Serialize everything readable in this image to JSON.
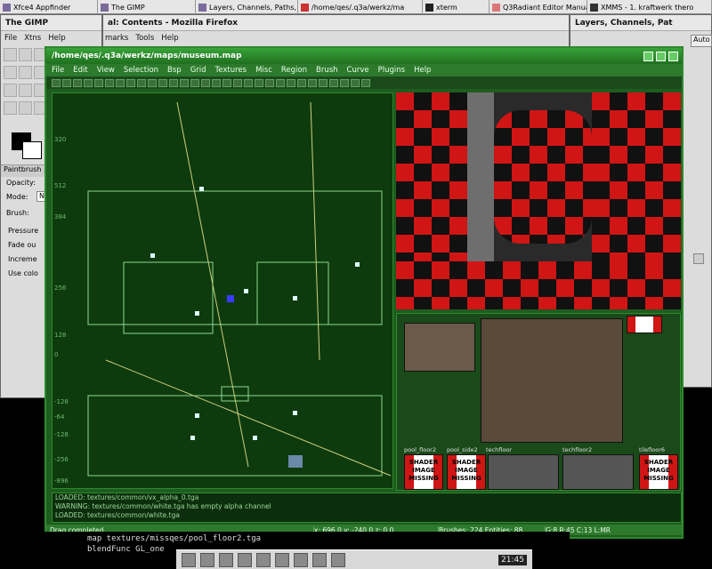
{
  "taskbar": {
    "items": [
      "Xfce4 Appfinder",
      "The GIMP",
      "Layers, Channels, Paths, U",
      "/home/qes/.q3a/werkz/ma",
      "xterm",
      "Q3Radiant Editor Manual: ",
      "XMMS - 1. kraftwerk thero"
    ]
  },
  "gimp": {
    "title": "The GIMP",
    "menu": [
      "File",
      "Xtns",
      "Help"
    ],
    "tool_options_title": "Paintbrush",
    "opacity_label": "Opacity:",
    "mode_label": "Mode:",
    "mode_value": "No",
    "brush_label": "Brush:",
    "pressure_label": "Pressure",
    "fade_label": "Fade ou",
    "increment_label": "Increme",
    "color_label": "Use colo"
  },
  "firefox": {
    "title": "al: Contents - Mozilla Firefox",
    "menu": [
      "marks",
      "Tools",
      "Help"
    ]
  },
  "layers": {
    "title": "Layers, Channels, Pat",
    "auto_label": "Auto"
  },
  "radiant": {
    "title": "/home/qes/.q3a/werkz/maps/museum.map",
    "menu": [
      "File",
      "Edit",
      "View",
      "Selection",
      "Bsp",
      "Grid",
      "Textures",
      "Misc",
      "Region",
      "Brush",
      "Curve",
      "Plugins",
      "Help"
    ],
    "grid_labels_y": [
      "320",
      "512",
      "384",
      "256",
      "128",
      "0",
      "-128",
      "-64",
      "-128",
      "-256",
      "-896"
    ],
    "textures": {
      "labels": [
        "pool_floor2",
        "pool_side2",
        "techfloor",
        "techfloor2",
        "tilefloor6"
      ],
      "missing_text": [
        "SHADER",
        "IMAGE",
        "MISSING"
      ]
    },
    "console": [
      "LOADED: textures/common/vx_alpha_0.tga",
      "WARNING: textures/common/white.tga has empty alpha channel",
      "LOADED: textures/common/white.tga"
    ],
    "status": {
      "message": "Drag completed.",
      "coords": "x: 696.0  y: -240.0  z: 0.0",
      "counts": "Brushes: 224 Entities: 88",
      "grid": "G:8 R:45 C:13 L:MR"
    }
  },
  "xterm": {
    "lines": [
      "map textures/missqes/pool_floor2.tga",
      "blendFunc GL_one"
    ]
  },
  "panel": {
    "clock": "21:45"
  },
  "colors": {
    "radiant_green": "#1f5c1f",
    "grid_bg": "#0d3b0d",
    "missing_red": "#d01515"
  }
}
